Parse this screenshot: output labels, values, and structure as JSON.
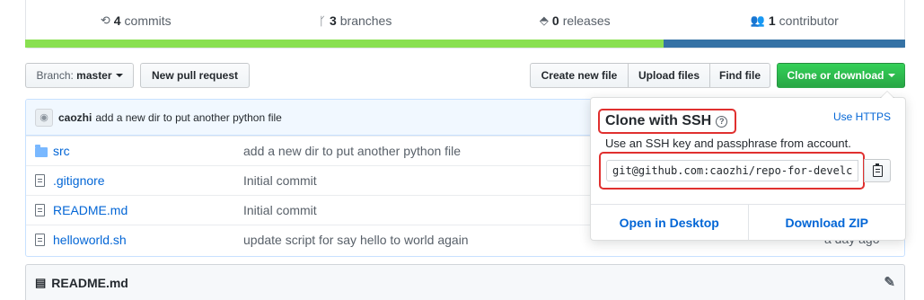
{
  "stats": {
    "commits": {
      "count": "4",
      "label": "commits"
    },
    "branches": {
      "count": "3",
      "label": "branches"
    },
    "releases": {
      "count": "0",
      "label": "releases"
    },
    "contributors": {
      "count": "1",
      "label": "contributor"
    }
  },
  "language_bar": {
    "colors": [
      "#89e051",
      "#3572a5"
    ]
  },
  "toolbar": {
    "branch_prefix": "Branch:",
    "branch_name": "master",
    "new_pull_request": "New pull request",
    "create_new_file": "Create new file",
    "upload_files": "Upload files",
    "find_file": "Find file",
    "clone_or_download": "Clone or download"
  },
  "commit_tease": {
    "author": "caozhi",
    "message": "add a new dir to put another python file"
  },
  "files": [
    {
      "name": "src",
      "type": "folder",
      "message": "add a new dir to put another python file"
    },
    {
      "name": ".gitignore",
      "type": "file",
      "message": "Initial commit"
    },
    {
      "name": "README.md",
      "type": "file",
      "message": "Initial commit"
    },
    {
      "name": "helloworld.sh",
      "type": "file",
      "message": "update script for say hello to world again"
    }
  ],
  "partial_age": "a day ago",
  "readme": {
    "title": "README.md"
  },
  "clone_dropdown": {
    "title": "Clone with SSH",
    "use_https": "Use HTTPS",
    "description": "Use an SSH key and passphrase from account.",
    "url": "git@github.com:caozhi/repo-for-develc",
    "open_desktop": "Open in Desktop",
    "download_zip": "Download ZIP"
  },
  "colors": {
    "accent_link": "#0366d6",
    "highlight_red": "#e0302f",
    "button_green": "#28a745"
  }
}
